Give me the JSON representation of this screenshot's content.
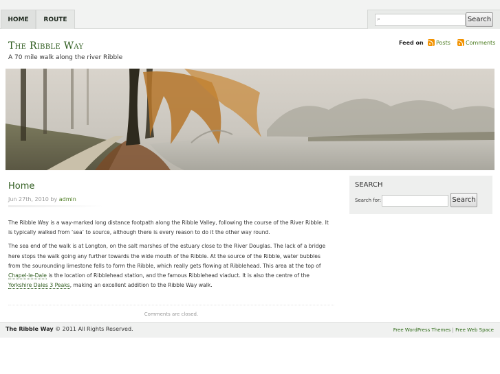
{
  "nav": {
    "tabs": [
      {
        "label": "HOME"
      },
      {
        "label": "ROUTE"
      }
    ],
    "search": {
      "placeholder": "",
      "button_label": "Search"
    }
  },
  "header": {
    "title": "The Ribble Way",
    "description": "A 70 mile walk along the river Ribble",
    "feed": {
      "label": "Feed on",
      "posts": "Posts",
      "comments": "Comments"
    }
  },
  "post": {
    "title": "Home",
    "date": "Jun 27th, 2010",
    "by": "by",
    "author": "admin",
    "p1": "The Ribble Way is a way-marked long distance footpath along the Ribble Valley, following the course of the River Ribble. It is typically walked from ‘sea’ to source, although there is every reason to do it the other way round.",
    "p2_a": "The sea end of the walk is at Longton, on the salt marshes of the estuary close to the River Douglas. The lack of a bridge here stops the walk going any further towards the wide mouth of the Ribble.  At the source of the Ribble, water bubbles from the sourounding limestone fells to form the Ribble, which really gets flowing at Ribblehead. This area at the top of ",
    "p2_link1": "Chapel-le-Dale",
    "p2_b": " is the location of Ribblehead station, and the famous Ribblehead viaduct.  It is also the centre of the ",
    "p2_link2": "Yorkshire Dales 3 Peaks",
    "p2_c": ", making an excellent addition to the Ribble Way walk.",
    "comments_closed": "Comments are closed."
  },
  "sidebar": {
    "heading": "SEARCH",
    "label": "Search for:",
    "button_label": "Search"
  },
  "footer": {
    "site_name": "The Ribble Way",
    "copyright": " © 2011 All Rights Reserved.",
    "link1": "Free WordPress Themes",
    "separator": " | ",
    "link2": "Free Web Space"
  },
  "colors": {
    "accent_green": "#2f5c1f",
    "link_green": "#4a7a1e",
    "rss_orange": "#f29200"
  }
}
